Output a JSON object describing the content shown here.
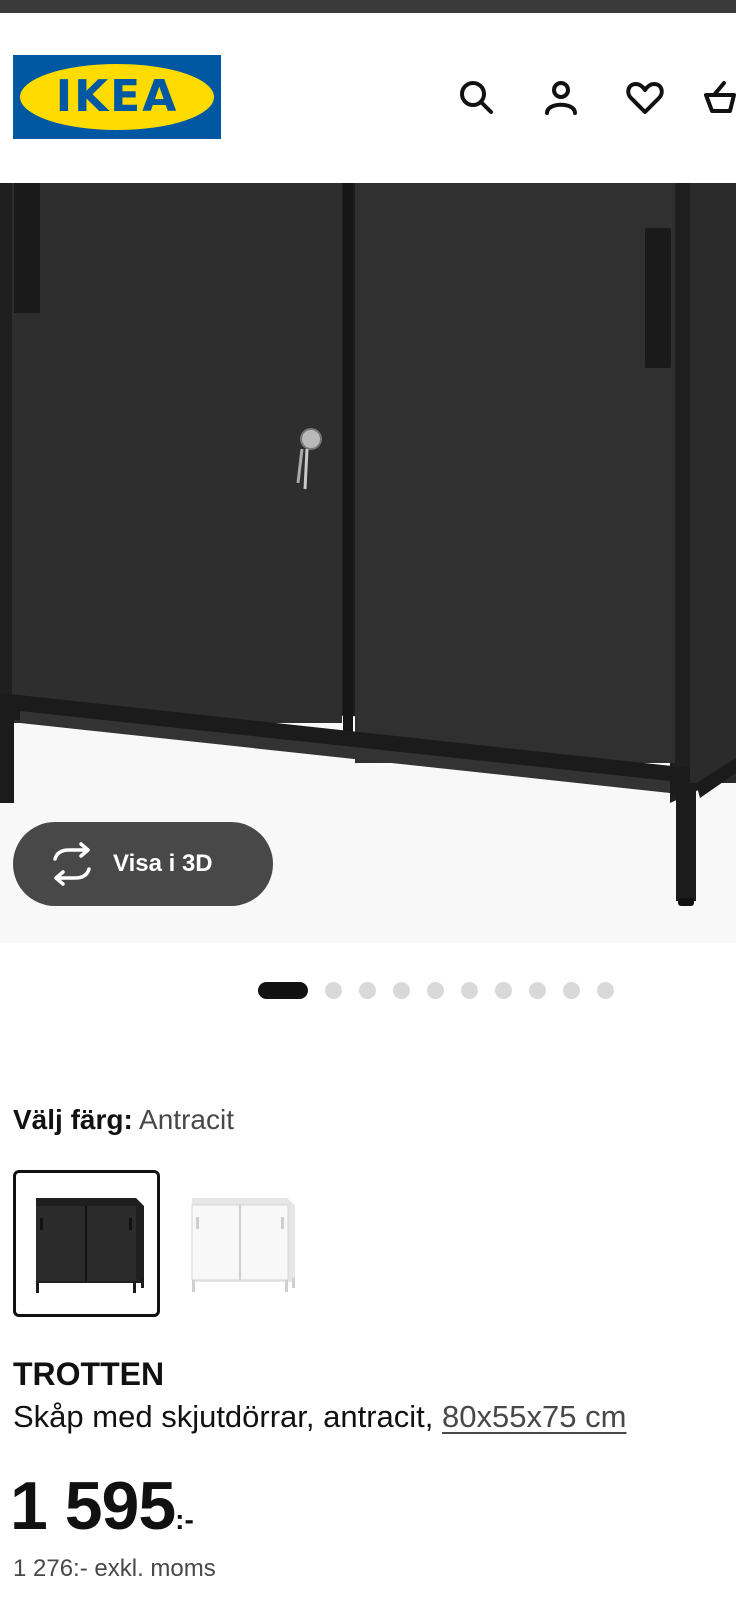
{
  "header": {
    "logo_text": "IKEA",
    "logo_registered_mark": "®",
    "brand_colors": {
      "blue": "#0058a3",
      "yellow": "#ffdb00"
    },
    "icons": [
      "search-icon",
      "user-icon",
      "heart-icon",
      "basket-icon"
    ]
  },
  "gallery": {
    "view_3d_label": "Visa i 3D",
    "view_3d_icon": "rotate-icon",
    "dot_count": 10,
    "active_index": 0
  },
  "color_picker": {
    "label": "Välj färg:",
    "selected_value": "Antracit",
    "options": [
      {
        "name": "anthracite-swatch",
        "color": "#2a2a2a"
      },
      {
        "name": "white-swatch",
        "color": "#f4f4f4"
      }
    ]
  },
  "product": {
    "name": "TROTTEN",
    "description_prefix": "Skåp med skjutdörrar, antracit,",
    "dimensions": "80x55x75 cm",
    "price_amount": "1 595",
    "price_suffix": ":-",
    "price_excl_vat": "1 276:- exkl. moms"
  }
}
